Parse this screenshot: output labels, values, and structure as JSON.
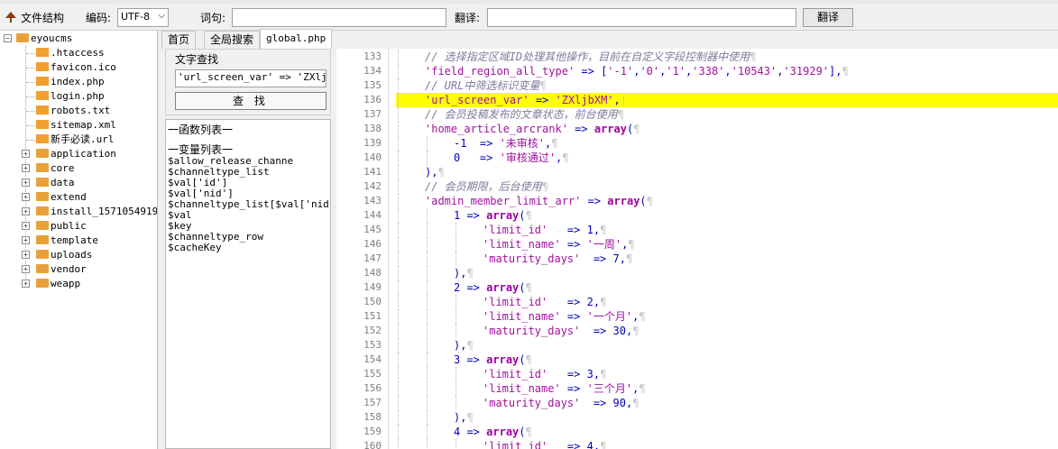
{
  "toolbar": {
    "file_structure_label": "文件结构",
    "encoding_label": "编码:",
    "encoding_value": "UTF-8",
    "word_label": "词句:",
    "word_value": "",
    "translate_label": "翻译:",
    "translate_value": "",
    "translate_button": "翻译"
  },
  "tree": {
    "root": "eyoucms",
    "files": [
      ".htaccess",
      "favicon.ico",
      "index.php",
      "login.php",
      "robots.txt",
      "sitemap.xml",
      "新手必读.url"
    ],
    "folders": [
      "application",
      "core",
      "data",
      "extend",
      "install_1571054919",
      "public",
      "template",
      "uploads",
      "vendor",
      "weapp"
    ]
  },
  "tabs": [
    "首页",
    "全局搜索",
    "global.php"
  ],
  "search": {
    "title": "文字查找",
    "input_value": "'url_screen_var' => 'ZXljbXM",
    "find_button": "查 找"
  },
  "funclist": {
    "func_header": "一函数列表一",
    "var_header": "一变量列表一",
    "vars": [
      "$allow_release_channe",
      "$channeltype_list",
      "$val['id']",
      "$val['nid']",
      "$channeltype_list[$val['nid']",
      "$val",
      "$key",
      "$channeltype_row",
      "$cacheKey"
    ]
  },
  "editor": {
    "highlight_line": 136,
    "lines": [
      {
        "n": "133",
        "indent": 1,
        "parts": [
          [
            "cm",
            "// 选择指定区域ID处理其他操作，目前在自定义字段控制器中使用"
          ],
          [
            "ws",
            "¶"
          ]
        ]
      },
      {
        "n": "134",
        "indent": 1,
        "parts": [
          [
            "st",
            "'field_region_all_type'"
          ],
          [
            "op",
            " => ["
          ],
          [
            "st",
            "'-1'"
          ],
          [
            "op",
            ","
          ],
          [
            "st",
            "'0'"
          ],
          [
            "op",
            ","
          ],
          [
            "st",
            "'1'"
          ],
          [
            "op",
            ","
          ],
          [
            "st",
            "'338'"
          ],
          [
            "op",
            ","
          ],
          [
            "st",
            "'10543'"
          ],
          [
            "op",
            ","
          ],
          [
            "st",
            "'31929'"
          ],
          [
            "op",
            "],"
          ],
          [
            "ws",
            "¶"
          ]
        ]
      },
      {
        "n": "135",
        "indent": 1,
        "parts": [
          [
            "cm",
            "// URL中筛选标识变量"
          ],
          [
            "ws",
            "¶"
          ]
        ]
      },
      {
        "n": "136",
        "indent": 1,
        "parts": [
          [
            "st",
            "'url_screen_var'"
          ],
          [
            "op",
            " => "
          ],
          [
            "st",
            "'ZXljbXM'"
          ],
          [
            "op",
            ","
          ],
          [
            "ws",
            "|"
          ]
        ]
      },
      {
        "n": "137",
        "indent": 1,
        "parts": [
          [
            "cm",
            "// 会员投稿发布的文章状态，前台使用"
          ],
          [
            "ws",
            "¶"
          ]
        ]
      },
      {
        "n": "138",
        "indent": 1,
        "parts": [
          [
            "st",
            "'home_article_arcrank'"
          ],
          [
            "op",
            " => "
          ],
          [
            "kw",
            "array"
          ],
          [
            "op",
            "("
          ],
          [
            "ws",
            "¶"
          ]
        ]
      },
      {
        "n": "139",
        "indent": 2,
        "parts": [
          [
            "nm",
            "-1"
          ],
          [
            "op",
            "  => "
          ],
          [
            "st",
            "'未审核'"
          ],
          [
            "op",
            ","
          ],
          [
            "ws",
            "¶"
          ]
        ]
      },
      {
        "n": "140",
        "indent": 2,
        "parts": [
          [
            "nm",
            "0"
          ],
          [
            "op",
            "   => "
          ],
          [
            "st",
            "'审核通过'"
          ],
          [
            "op",
            ","
          ],
          [
            "ws",
            "¶"
          ]
        ]
      },
      {
        "n": "141",
        "indent": 1,
        "parts": [
          [
            "op",
            "),"
          ],
          [
            "ws",
            "¶"
          ]
        ]
      },
      {
        "n": "142",
        "indent": 1,
        "parts": [
          [
            "cm",
            "// 会员期限，后台使用"
          ],
          [
            "ws",
            "¶"
          ]
        ]
      },
      {
        "n": "143",
        "indent": 1,
        "parts": [
          [
            "st",
            "'admin_member_limit_arr'"
          ],
          [
            "op",
            " => "
          ],
          [
            "kw",
            "array"
          ],
          [
            "op",
            "("
          ],
          [
            "ws",
            "¶"
          ]
        ]
      },
      {
        "n": "144",
        "indent": 2,
        "parts": [
          [
            "nm",
            "1"
          ],
          [
            "op",
            " => "
          ],
          [
            "kw",
            "array"
          ],
          [
            "op",
            "("
          ],
          [
            "ws",
            "¶"
          ]
        ]
      },
      {
        "n": "145",
        "indent": 3,
        "parts": [
          [
            "st",
            "'limit_id'"
          ],
          [
            "op",
            "   => "
          ],
          [
            "nm",
            "1"
          ],
          [
            "op",
            ","
          ],
          [
            "ws",
            "¶"
          ]
        ]
      },
      {
        "n": "146",
        "indent": 3,
        "parts": [
          [
            "st",
            "'limit_name'"
          ],
          [
            "op",
            " => "
          ],
          [
            "st",
            "'一周'"
          ],
          [
            "op",
            ","
          ],
          [
            "ws",
            "¶"
          ]
        ]
      },
      {
        "n": "147",
        "indent": 3,
        "parts": [
          [
            "st",
            "'maturity_days'"
          ],
          [
            "op",
            "  => "
          ],
          [
            "nm",
            "7"
          ],
          [
            "op",
            ","
          ],
          [
            "ws",
            "¶"
          ]
        ]
      },
      {
        "n": "148",
        "indent": 2,
        "parts": [
          [
            "op",
            "),"
          ],
          [
            "ws",
            "¶"
          ]
        ]
      },
      {
        "n": "149",
        "indent": 2,
        "parts": [
          [
            "nm",
            "2"
          ],
          [
            "op",
            " => "
          ],
          [
            "kw",
            "array"
          ],
          [
            "op",
            "("
          ],
          [
            "ws",
            "¶"
          ]
        ]
      },
      {
        "n": "150",
        "indent": 3,
        "parts": [
          [
            "st",
            "'limit_id'"
          ],
          [
            "op",
            "   => "
          ],
          [
            "nm",
            "2"
          ],
          [
            "op",
            ","
          ],
          [
            "ws",
            "¶"
          ]
        ]
      },
      {
        "n": "151",
        "indent": 3,
        "parts": [
          [
            "st",
            "'limit_name'"
          ],
          [
            "op",
            " => "
          ],
          [
            "st",
            "'一个月'"
          ],
          [
            "op",
            ","
          ],
          [
            "ws",
            "¶"
          ]
        ]
      },
      {
        "n": "152",
        "indent": 3,
        "parts": [
          [
            "st",
            "'maturity_days'"
          ],
          [
            "op",
            "  => "
          ],
          [
            "nm",
            "30"
          ],
          [
            "op",
            ","
          ],
          [
            "ws",
            "¶"
          ]
        ]
      },
      {
        "n": "153",
        "indent": 2,
        "parts": [
          [
            "op",
            "),"
          ],
          [
            "ws",
            "¶"
          ]
        ]
      },
      {
        "n": "154",
        "indent": 2,
        "parts": [
          [
            "nm",
            "3"
          ],
          [
            "op",
            " => "
          ],
          [
            "kw",
            "array"
          ],
          [
            "op",
            "("
          ],
          [
            "ws",
            "¶"
          ]
        ]
      },
      {
        "n": "155",
        "indent": 3,
        "parts": [
          [
            "st",
            "'limit_id'"
          ],
          [
            "op",
            "   => "
          ],
          [
            "nm",
            "3"
          ],
          [
            "op",
            ","
          ],
          [
            "ws",
            "¶"
          ]
        ]
      },
      {
        "n": "156",
        "indent": 3,
        "parts": [
          [
            "st",
            "'limit_name'"
          ],
          [
            "op",
            " => "
          ],
          [
            "st",
            "'三个月'"
          ],
          [
            "op",
            ","
          ],
          [
            "ws",
            "¶"
          ]
        ]
      },
      {
        "n": "157",
        "indent": 3,
        "parts": [
          [
            "st",
            "'maturity_days'"
          ],
          [
            "op",
            "  => "
          ],
          [
            "nm",
            "90"
          ],
          [
            "op",
            ","
          ],
          [
            "ws",
            "¶"
          ]
        ]
      },
      {
        "n": "158",
        "indent": 2,
        "parts": [
          [
            "op",
            "),"
          ],
          [
            "ws",
            "¶"
          ]
        ]
      },
      {
        "n": "159",
        "indent": 2,
        "parts": [
          [
            "nm",
            "4"
          ],
          [
            "op",
            " => "
          ],
          [
            "kw",
            "array"
          ],
          [
            "op",
            "("
          ],
          [
            "ws",
            "¶"
          ]
        ]
      },
      {
        "n": "160",
        "indent": 3,
        "parts": [
          [
            "st",
            "'limit_id'"
          ],
          [
            "op",
            "   => "
          ],
          [
            "nm",
            "4"
          ],
          [
            "op",
            ","
          ],
          [
            "ws",
            "¶"
          ]
        ]
      }
    ]
  },
  "colors": {
    "highlight": "#ffff00",
    "string": "#a0129e",
    "comment": "#7b7b9b",
    "keyword": "#a000a0",
    "number": "#0000c0",
    "folder": "#e8a13a"
  }
}
